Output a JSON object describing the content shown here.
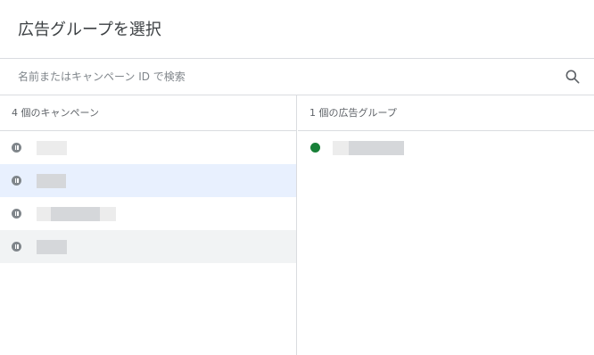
{
  "dialog": {
    "title": "広告グループを選択"
  },
  "search": {
    "placeholder": "名前またはキャンペーン ID で検索",
    "icon": "search-icon"
  },
  "campaigns": {
    "header": "4 個のキャンペーン",
    "items": [
      {
        "status": "paused",
        "status_icon": "pause-icon",
        "name": ""
      },
      {
        "status": "paused",
        "status_icon": "pause-icon",
        "name": "",
        "state": "selected"
      },
      {
        "status": "paused",
        "status_icon": "pause-icon",
        "name": ""
      },
      {
        "status": "paused",
        "status_icon": "pause-icon",
        "name": "",
        "state": "hovered"
      }
    ]
  },
  "ad_groups": {
    "header": "1 個の広告グループ",
    "items": [
      {
        "status": "enabled",
        "status_icon": "enabled-icon",
        "name": ""
      }
    ]
  },
  "colors": {
    "selected_row": "#e8f0fe",
    "hovered_row": "#f1f3f4",
    "enabled_dot": "#188038",
    "paused_icon": "#80868b",
    "divider": "#dadce0"
  }
}
